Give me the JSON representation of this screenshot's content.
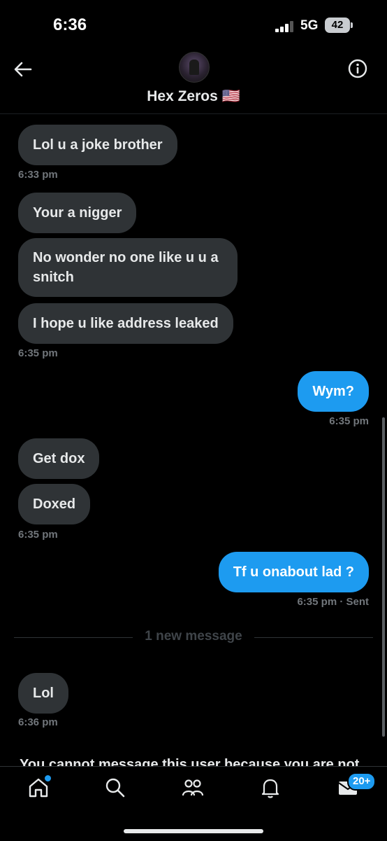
{
  "status": {
    "time": "6:36",
    "network": "5G",
    "battery": "42"
  },
  "header": {
    "title": "Hex Zeros 🇺🇸"
  },
  "messages": [
    {
      "text": "Lol u a joke brother"
    },
    {
      "time": "6:33 pm"
    },
    {
      "text": "Your a nigger"
    },
    {
      "text": "No wonder no one like u u a\nsnitch"
    },
    {
      "text": "I hope u like address leaked"
    },
    {
      "time": "6:35 pm"
    },
    {
      "text": "Wym?"
    },
    {
      "time": "6:35 pm"
    },
    {
      "text": "Get dox"
    },
    {
      "text": "Doxed"
    },
    {
      "time": "6:35 pm"
    },
    {
      "text": "Tf u onabout lad ?"
    },
    {
      "time": "6:35 pm · Sent"
    },
    {
      "text": "Lol"
    },
    {
      "time": "6:36 pm"
    }
  ],
  "new_message_divider": "1 new message",
  "cannot_message_text": "You cannot message this user because you are not",
  "tabbar": {
    "messages_badge": "20+"
  },
  "colors": {
    "accent": "#1d9bf0",
    "incoming_bubble": "#2f3336",
    "background": "#000000"
  }
}
